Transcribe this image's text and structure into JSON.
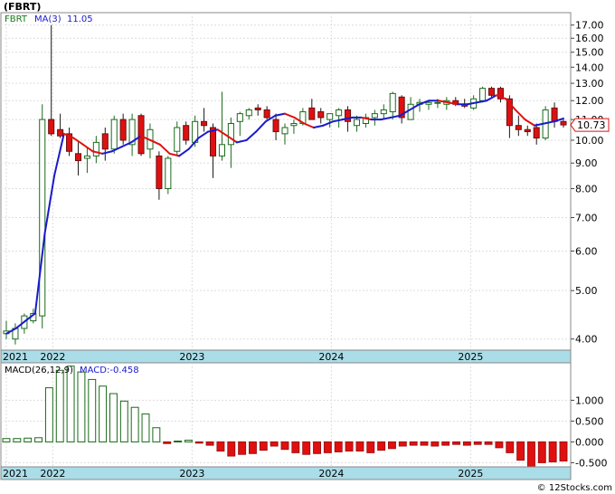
{
  "ticker": "(FBRT)",
  "chart_data": [
    {
      "type": "candlestick",
      "label": "FBRT",
      "ma_label": "MA(3)",
      "ma_value": "11.05",
      "last_price": "10.73",
      "y_scale": "log",
      "ylim": [
        3.8,
        18.0
      ],
      "y_ticks": [
        "4.00",
        "5.00",
        "6.00",
        "7.00",
        "8.00",
        "9.00",
        "10.00",
        "11.00",
        "12.00",
        "13.00",
        "14.00",
        "15.00",
        "16.00",
        "17.00"
      ],
      "x_ticks": [
        "2021",
        "2022",
        "2023",
        "2024",
        "2025"
      ],
      "months": [
        "2021-09",
        "2021-10",
        "2021-11",
        "2021-12",
        "2022-01",
        "2022-02",
        "2022-03",
        "2022-04",
        "2022-05",
        "2022-06",
        "2022-07",
        "2022-08",
        "2022-09",
        "2022-10",
        "2022-11",
        "2022-12",
        "2023-01",
        "2023-02",
        "2023-03",
        "2023-04",
        "2023-05",
        "2023-06",
        "2023-07",
        "2023-08",
        "2023-09",
        "2023-10",
        "2023-11",
        "2023-12",
        "2024-01",
        "2024-02",
        "2024-03",
        "2024-04",
        "2024-05",
        "2024-06",
        "2024-07",
        "2024-08",
        "2024-09",
        "2024-10",
        "2024-11",
        "2024-12",
        "2025-01",
        "2025-02",
        "2025-03",
        "2025-04",
        "2025-05",
        "2025-06",
        "2025-07",
        "2025-08",
        "2025-09"
      ],
      "candles": [
        [
          4.1,
          4.35,
          4.0,
          4.15
        ],
        [
          4.0,
          4.3,
          3.9,
          4.2
        ],
        [
          4.2,
          4.5,
          4.1,
          4.45
        ],
        [
          4.35,
          4.6,
          4.3,
          4.5
        ],
        [
          4.45,
          11.8,
          4.2,
          11.0
        ],
        [
          11.0,
          17.0,
          10.2,
          10.3
        ],
        [
          10.5,
          11.3,
          10.1,
          10.2
        ],
        [
          10.3,
          10.6,
          9.3,
          9.5
        ],
        [
          9.4,
          9.9,
          8.5,
          9.1
        ],
        [
          9.2,
          9.7,
          8.6,
          9.3
        ],
        [
          9.3,
          10.2,
          9.0,
          9.9
        ],
        [
          10.3,
          10.6,
          9.1,
          9.6
        ],
        [
          9.6,
          11.2,
          9.4,
          11.0
        ],
        [
          11.0,
          11.3,
          9.8,
          10.0
        ],
        [
          9.8,
          11.3,
          9.3,
          11.0
        ],
        [
          11.2,
          11.3,
          9.3,
          9.4
        ],
        [
          9.6,
          10.8,
          9.2,
          10.5
        ],
        [
          9.3,
          9.5,
          7.6,
          8.0
        ],
        [
          8.0,
          9.3,
          7.8,
          9.2
        ],
        [
          9.5,
          10.9,
          9.3,
          10.6
        ],
        [
          10.7,
          10.9,
          9.8,
          10.0
        ],
        [
          9.9,
          11.2,
          9.7,
          10.9
        ],
        [
          10.9,
          11.6,
          10.4,
          10.7
        ],
        [
          10.6,
          10.8,
          8.4,
          9.3
        ],
        [
          9.3,
          12.5,
          9.1,
          9.8
        ],
        [
          9.8,
          11.1,
          8.8,
          10.8
        ],
        [
          10.9,
          11.4,
          10.2,
          11.3
        ],
        [
          11.2,
          11.6,
          11.0,
          11.5
        ],
        [
          11.6,
          11.8,
          11.2,
          11.5
        ],
        [
          11.5,
          11.7,
          11.0,
          11.1
        ],
        [
          11.0,
          11.3,
          10.0,
          10.4
        ],
        [
          10.3,
          10.8,
          9.8,
          10.6
        ],
        [
          10.7,
          11.0,
          10.3,
          10.8
        ],
        [
          10.8,
          11.6,
          10.7,
          11.4
        ],
        [
          11.6,
          12.1,
          11.0,
          11.0
        ],
        [
          11.4,
          11.6,
          10.8,
          11.1
        ],
        [
          11.0,
          11.3,
          10.6,
          11.3
        ],
        [
          11.2,
          11.6,
          10.6,
          11.5
        ],
        [
          11.5,
          11.7,
          10.4,
          10.9
        ],
        [
          10.7,
          11.2,
          10.4,
          11.0
        ],
        [
          10.8,
          11.3,
          10.6,
          11.1
        ],
        [
          11.1,
          11.5,
          10.7,
          11.3
        ],
        [
          11.3,
          11.8,
          11.0,
          11.5
        ],
        [
          11.4,
          12.5,
          11.0,
          12.4
        ],
        [
          12.2,
          12.3,
          10.8,
          11.1
        ],
        [
          11.0,
          12.2,
          11.0,
          11.8
        ],
        [
          11.8,
          12.1,
          11.4,
          11.9
        ],
        [
          11.8,
          12.0,
          11.5,
          11.9
        ],
        [
          11.9,
          12.1,
          11.6,
          11.9
        ],
        [
          11.8,
          12.2,
          11.5,
          12.0
        ],
        [
          12.0,
          12.2,
          11.7,
          11.8
        ],
        [
          11.8,
          12.1,
          11.6,
          11.7
        ],
        [
          11.6,
          12.3,
          11.5,
          12.1
        ],
        [
          12.0,
          12.8,
          11.9,
          12.7
        ],
        [
          12.7,
          12.8,
          12.2,
          12.3
        ],
        [
          12.7,
          12.8,
          11.9,
          12.1
        ],
        [
          12.1,
          12.3,
          10.1,
          10.7
        ],
        [
          10.7,
          11.2,
          10.2,
          10.5
        ],
        [
          10.5,
          10.7,
          10.2,
          10.4
        ],
        [
          10.6,
          10.8,
          9.8,
          10.1
        ],
        [
          10.1,
          11.7,
          10.0,
          11.5
        ],
        [
          11.6,
          11.9,
          10.6,
          10.9
        ],
        [
          10.9,
          11.0,
          10.6,
          10.73
        ]
      ],
      "ma": [
        4.1,
        4.2,
        4.35,
        4.5,
        6.5,
        8.5,
        10.3,
        10.1,
        9.8,
        9.5,
        9.4,
        9.5,
        9.7,
        9.9,
        10.2,
        10.0,
        9.8,
        9.4,
        9.3,
        9.6,
        10.1,
        10.4,
        10.5,
        10.2,
        9.9,
        10.0,
        10.4,
        10.9,
        11.2,
        11.3,
        11.1,
        10.8,
        10.6,
        10.7,
        10.9,
        11.0,
        11.1,
        11.1,
        11.0,
        11.0,
        11.1,
        11.2,
        11.5,
        11.8,
        12.0,
        12.0,
        11.9,
        11.8,
        11.8,
        11.9,
        12.0,
        12.3,
        12.1,
        11.5,
        11.0,
        10.7,
        10.8,
        10.9,
        11.05
      ]
    },
    {
      "type": "bar",
      "label": "MACD(26,12,9)",
      "value_label": "MACD:-0.458",
      "ylim": [
        -0.6,
        1.9
      ],
      "y_ticks": [
        "1.000",
        "0.500",
        "0.000",
        "-0.500"
      ],
      "x_ticks": [
        "2021",
        "2022",
        "2023",
        "2024",
        "2025"
      ],
      "values": [
        0.08,
        0.08,
        0.09,
        0.1,
        1.3,
        1.72,
        1.82,
        1.68,
        1.5,
        1.34,
        1.16,
        0.98,
        0.83,
        0.67,
        0.34,
        -0.04,
        0.02,
        0.04,
        -0.03,
        -0.08,
        -0.22,
        -0.34,
        -0.3,
        -0.28,
        -0.2,
        -0.1,
        -0.18,
        -0.26,
        -0.3,
        -0.28,
        -0.26,
        -0.24,
        -0.22,
        -0.22,
        -0.26,
        -0.2,
        -0.16,
        -0.1,
        -0.08,
        -0.08,
        -0.1,
        -0.08,
        -0.06,
        -0.08,
        -0.06,
        -0.06,
        -0.14,
        -0.26,
        -0.44,
        -0.62,
        -0.5,
        -0.48,
        -0.46
      ]
    }
  ],
  "watermark": "© 12Stocks.com"
}
